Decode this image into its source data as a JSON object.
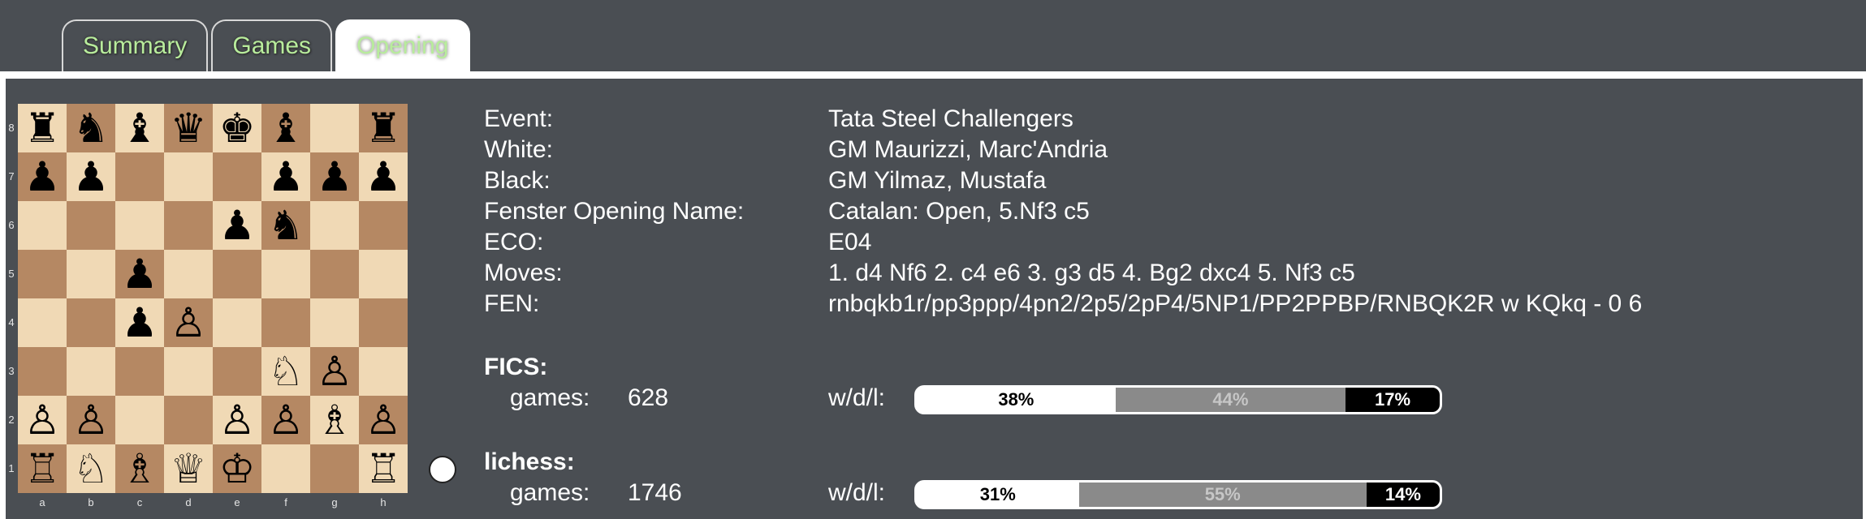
{
  "tabs": [
    {
      "label": "Summary",
      "active": false
    },
    {
      "label": "Games",
      "active": false
    },
    {
      "label": "Opening",
      "active": true
    }
  ],
  "board": {
    "ranks": [
      "8",
      "7",
      "6",
      "5",
      "4",
      "3",
      "2",
      "1"
    ],
    "files": [
      "a",
      "b",
      "c",
      "d",
      "e",
      "f",
      "g",
      "h"
    ],
    "position": [
      [
        "♜",
        "♞",
        "♝",
        "♛",
        "♚",
        "♝",
        "",
        "♜"
      ],
      [
        "♟",
        "♟",
        "",
        "",
        "",
        "♟",
        "♟",
        "♟"
      ],
      [
        "",
        "",
        "",
        "",
        "♟",
        "♞",
        "",
        ""
      ],
      [
        "",
        "",
        "♟",
        "",
        "",
        "",
        "",
        ""
      ],
      [
        "",
        "",
        "♟",
        "♙",
        "",
        "",
        "",
        ""
      ],
      [
        "",
        "",
        "",
        "",
        "",
        "♘",
        "♙",
        ""
      ],
      [
        "♙",
        "♙",
        "",
        "",
        "♙",
        "♙",
        "♗",
        "♙"
      ],
      [
        "♖",
        "♘",
        "♗",
        "♕",
        "♔",
        "",
        "",
        "♖"
      ]
    ],
    "side_to_move": "white"
  },
  "game_info": {
    "event_label": "Event:",
    "event_value": "Tata Steel Challengers",
    "white_label": "White:",
    "white_value": "GM Maurizzi, Marc'Andria",
    "black_label": "Black:",
    "black_value": "GM Yilmaz, Mustafa",
    "opening_label": "Fenster Opening Name:",
    "opening_value": "Catalan: Open, 5.Nf3 c5",
    "eco_label": "ECO:",
    "eco_value": "E04",
    "moves_label": "Moves:",
    "moves_value": "1. d4 Nf6 2. c4 e6 3. g3 d5 4. Bg2 dxc4 5. Nf3 c5",
    "fen_label": "FEN:",
    "fen_value": "rnbqkb1r/pp3ppp/4pn2/2p5/2pP4/5NP1/PP2PPBP/RNBQK2R w KQkq - 0 6"
  },
  "stats": [
    {
      "source": "FICS:",
      "games_label": "games:",
      "games": "628",
      "wdl_label": "w/d/l:",
      "win": "38%",
      "draw": "44%",
      "loss": "17%",
      "win_frac": 0.38,
      "draw_frac": 0.44,
      "loss_frac": 0.18
    },
    {
      "source": "lichess:",
      "games_label": "games:",
      "games": "1746",
      "wdl_label": "w/d/l:",
      "win": "31%",
      "draw": "55%",
      "loss": "14%",
      "win_frac": 0.31,
      "draw_frac": 0.55,
      "loss_frac": 0.14
    }
  ]
}
